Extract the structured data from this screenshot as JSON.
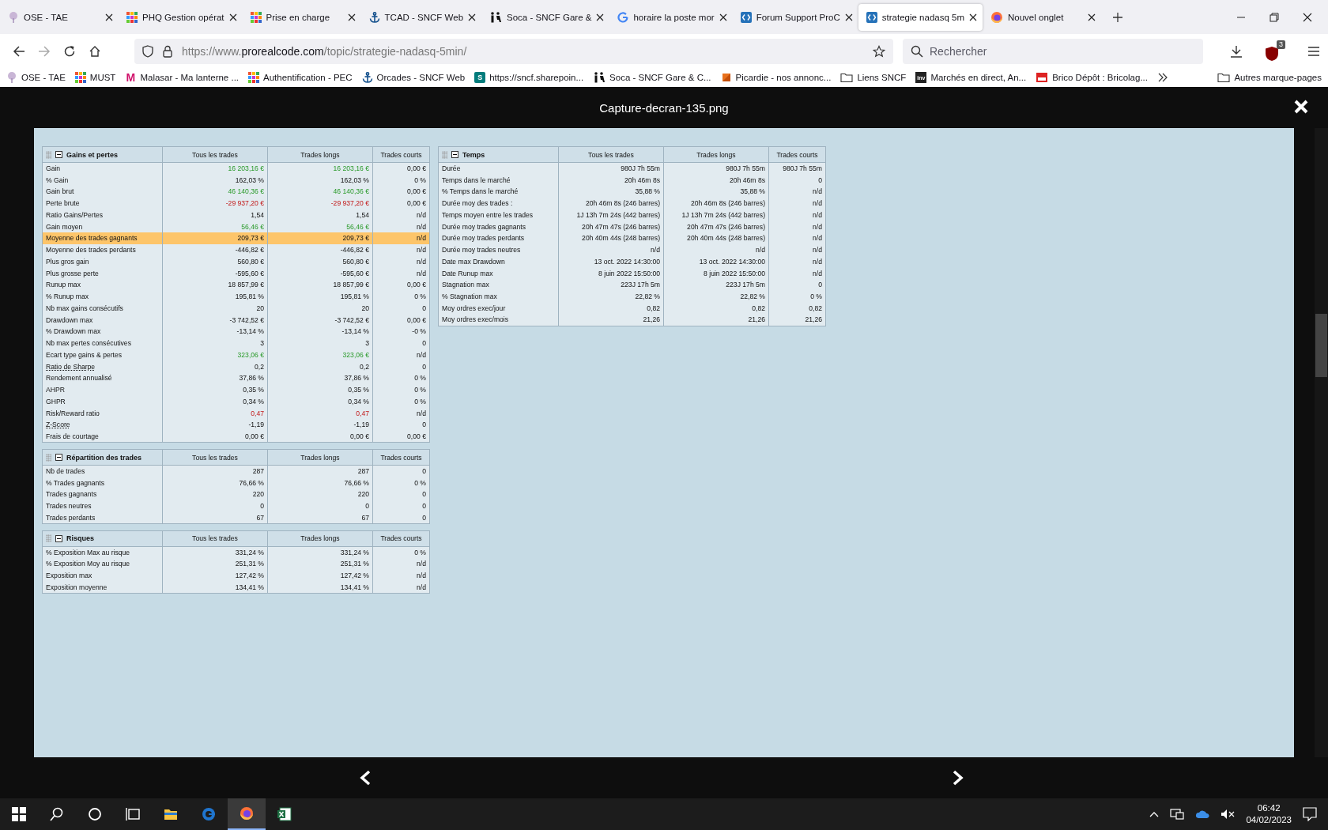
{
  "tabs": [
    {
      "title": "OSE - TAE",
      "kind": "flower",
      "selected": false
    },
    {
      "title": "PHQ Gestion opérat",
      "kind": "grid",
      "selected": false
    },
    {
      "title": "Prise en charge",
      "kind": "grid",
      "selected": false
    },
    {
      "title": "TCAD - SNCF Web",
      "kind": "anchor",
      "selected": false
    },
    {
      "title": "Soca - SNCF Gare &",
      "kind": "people",
      "selected": false
    },
    {
      "title": "horaire la poste mor",
      "kind": "google",
      "selected": false
    },
    {
      "title": "Forum Support ProC",
      "kind": "code",
      "selected": false
    },
    {
      "title": "strategie nadasq 5m",
      "kind": "code",
      "selected": true
    },
    {
      "title": "Nouvel onglet",
      "kind": "firefox",
      "selected": false
    }
  ],
  "address": {
    "prefix": "https://www.",
    "host": "prorealcode.com",
    "path": "/topic/strategie-nadasq-5min/"
  },
  "search": {
    "placeholder": "Rechercher"
  },
  "extension_badge": "3",
  "bookmarks": [
    {
      "label": "OSE - TAE",
      "kind": "flower"
    },
    {
      "label": "MUST",
      "kind": "grid"
    },
    {
      "label": "Malasar - Ma lanterne ...",
      "kind": "letter",
      "icon_text": "M"
    },
    {
      "label": "Authentification - PEC",
      "kind": "grid"
    },
    {
      "label": "Orcades - SNCF Web",
      "kind": "anchor"
    },
    {
      "label": "https://sncf.sharepoin...",
      "kind": "tile",
      "icon_text": "S"
    },
    {
      "label": "Soca - SNCF Gare & C...",
      "kind": "people"
    },
    {
      "label": "Picardie - nos annonc...",
      "kind": "square"
    },
    {
      "label": "Liens SNCF",
      "kind": "folder"
    },
    {
      "label": "Marchés en direct, An...",
      "kind": "dark",
      "icon_text": "inv"
    },
    {
      "label": "Brico Dépôt : Bricolag...",
      "kind": "brick"
    },
    {
      "label": "Autres marque-pages",
      "kind": "folder"
    }
  ],
  "viewer": {
    "title": "Capture-decran-135.png",
    "left_tables": [
      {
        "title": "Gains et pertes",
        "columns": [
          "Tous les trades",
          "Trades longs",
          "Trades courts"
        ],
        "rows": [
          {
            "label": "Gain",
            "values": [
              "16 203,16 €",
              "16 203,16 €",
              "0,00 €"
            ],
            "kind": "positive",
            "selected": false,
            "link": false
          },
          {
            "label": "% Gain",
            "values": [
              "162,03 %",
              "162,03 %",
              "0 %"
            ],
            "selected": false,
            "link": false
          },
          {
            "label": "Gain brut",
            "values": [
              "46 140,36 €",
              "46 140,36 €",
              "0,00 €"
            ],
            "kind": "positive",
            "selected": false,
            "link": false
          },
          {
            "label": "Perte brute",
            "values": [
              "-29 937,20 €",
              "-29 937,20 €",
              "0,00 €"
            ],
            "kind": "negative",
            "selected": false,
            "link": false
          },
          {
            "label": "Ratio Gains/Pertes",
            "values": [
              "1,54",
              "1,54",
              "n/d"
            ],
            "selected": false,
            "link": false
          },
          {
            "label": "Gain moyen",
            "values": [
              "56,46 €",
              "56,46 €",
              "n/d"
            ],
            "kind": "positive",
            "selected": false,
            "link": false
          },
          {
            "label": "Moyenne des trades gagnants",
            "values": [
              "209,73 €",
              "209,73 €",
              "n/d"
            ],
            "selected": true,
            "link": false
          },
          {
            "label": "Moyenne des trades perdants",
            "values": [
              "-446,82 €",
              "-446,82 €",
              "n/d"
            ],
            "selected": false,
            "link": false
          },
          {
            "label": "Plus gros gain",
            "values": [
              "560,80 €",
              "560,80 €",
              "n/d"
            ],
            "selected": false,
            "link": false
          },
          {
            "label": "Plus grosse perte",
            "values": [
              "-595,60 €",
              "-595,60 €",
              "n/d"
            ],
            "selected": false,
            "link": false
          },
          {
            "label": "Runup max",
            "values": [
              "18 857,99 €",
              "18 857,99 €",
              "0,00 €"
            ],
            "selected": false,
            "link": false
          },
          {
            "label": "% Runup max",
            "values": [
              "195,81 %",
              "195,81 %",
              "0 %"
            ],
            "selected": false,
            "link": false
          },
          {
            "label": "Nb max gains consécutifs",
            "values": [
              "20",
              "20",
              "0"
            ],
            "selected": false,
            "link": false
          },
          {
            "label": "Drawdown max",
            "values": [
              "-3 742,52 €",
              "-3 742,52 €",
              "0,00 €"
            ],
            "selected": false,
            "link": false
          },
          {
            "label": "% Drawdown max",
            "values": [
              "-13,14 %",
              "-13,14 %",
              "-0 %"
            ],
            "selected": false,
            "link": false
          },
          {
            "label": "Nb max pertes consécutives",
            "values": [
              "3",
              "3",
              "0"
            ],
            "selected": false,
            "link": false
          },
          {
            "label": "Ecart type gains & pertes",
            "values": [
              "323,06 €",
              "323,06 €",
              "n/d"
            ],
            "kind": "positive",
            "selected": false,
            "link": false
          },
          {
            "label": "Ratio de Sharpe",
            "values": [
              "0,2",
              "0,2",
              "0"
            ],
            "selected": false,
            "link": true
          },
          {
            "label": "Rendement annualisé",
            "values": [
              "37,86 %",
              "37,86 %",
              "0 %"
            ],
            "selected": false,
            "link": false
          },
          {
            "label": "AHPR",
            "values": [
              "0,35 %",
              "0,35 %",
              "0 %"
            ],
            "selected": false,
            "link": false
          },
          {
            "label": "GHPR",
            "values": [
              "0,34 %",
              "0,34 %",
              "0 %"
            ],
            "selected": false,
            "link": false
          },
          {
            "label": "Risk/Reward ratio",
            "values": [
              "0,47",
              "0,47",
              "n/d"
            ],
            "kind": "negative",
            "selected": false,
            "link": false
          },
          {
            "label": "Z-Score",
            "values": [
              "-1,19",
              "-1,19",
              "0"
            ],
            "selected": false,
            "link": true
          },
          {
            "label": "Frais de courtage",
            "values": [
              "0,00 €",
              "0,00 €",
              "0,00 €"
            ],
            "selected": false,
            "link": false
          }
        ]
      },
      {
        "title": "Répartition des trades",
        "columns": [
          "Tous les trades",
          "Trades longs",
          "Trades courts"
        ],
        "rows": [
          {
            "label": "Nb de trades",
            "values": [
              "287",
              "287",
              "0"
            ],
            "selected": false,
            "link": false
          },
          {
            "label": "% Trades gagnants",
            "values": [
              "76,66 %",
              "76,66 %",
              "0 %"
            ],
            "selected": false,
            "link": false
          },
          {
            "label": "Trades gagnants",
            "values": [
              "220",
              "220",
              "0"
            ],
            "selected": false,
            "link": false
          },
          {
            "label": "Trades neutres",
            "values": [
              "0",
              "0",
              "0"
            ],
            "selected": false,
            "link": false
          },
          {
            "label": "Trades perdants",
            "values": [
              "67",
              "67",
              "0"
            ],
            "selected": false,
            "link": false
          }
        ]
      },
      {
        "title": "Risques",
        "columns": [
          "Tous les trades",
          "Trades longs",
          "Trades courts"
        ],
        "rows": [
          {
            "label": "% Exposition Max au risque",
            "values": [
              "331,24 %",
              "331,24 %",
              "0 %"
            ],
            "selected": false,
            "link": false
          },
          {
            "label": "% Exposition Moy au risque",
            "values": [
              "251,31 %",
              "251,31 %",
              "n/d"
            ],
            "selected": false,
            "link": false
          },
          {
            "label": "Exposition max",
            "values": [
              "127,42 %",
              "127,42 %",
              "n/d"
            ],
            "selected": false,
            "link": false
          },
          {
            "label": "Exposition moyenne",
            "values": [
              "134,41 %",
              "134,41 %",
              "n/d"
            ],
            "selected": false,
            "link": false
          }
        ]
      }
    ],
    "right_tables": [
      {
        "title": "Temps",
        "columns": [
          "Tous les trades",
          "Trades longs",
          "Trades courts"
        ],
        "rows": [
          {
            "label": "Durée",
            "values": [
              "980J 7h 55m",
              "980J 7h 55m",
              "980J 7h 55m"
            ],
            "selected": false,
            "link": false
          },
          {
            "label": "Temps dans le marché",
            "values": [
              "20h 46m 8s",
              "20h 46m 8s",
              "0"
            ],
            "selected": false,
            "link": false
          },
          {
            "label": "% Temps dans le marché",
            "values": [
              "35,88 %",
              "35,88 %",
              "n/d"
            ],
            "selected": false,
            "link": false
          },
          {
            "label": "Durée moy des trades :",
            "values": [
              "20h 46m 8s (246 barres)",
              "20h 46m 8s (246 barres)",
              "n/d"
            ],
            "selected": false,
            "link": false
          },
          {
            "label": "Temps moyen entre les trades",
            "values": [
              "1J 13h 7m 24s (442 barres)",
              "1J 13h 7m 24s (442 barres)",
              "n/d"
            ],
            "selected": false,
            "link": false
          },
          {
            "label": "Durée moy trades gagnants",
            "values": [
              "20h 47m 47s (246 barres)",
              "20h 47m 47s (246 barres)",
              "n/d"
            ],
            "selected": false,
            "link": false
          },
          {
            "label": "Durée moy trades perdants",
            "values": [
              "20h 40m 44s (248 barres)",
              "20h 40m 44s (248 barres)",
              "n/d"
            ],
            "selected": false,
            "link": false
          },
          {
            "label": "Durée moy trades neutres",
            "values": [
              "n/d",
              "n/d",
              "n/d"
            ],
            "selected": false,
            "link": false
          },
          {
            "label": "Date max Drawdown",
            "values": [
              "13 oct. 2022 14:30:00",
              "13 oct. 2022 14:30:00",
              "n/d"
            ],
            "selected": false,
            "link": false
          },
          {
            "label": "Date Runup max",
            "values": [
              "8 juin 2022 15:50:00",
              "8 juin 2022 15:50:00",
              "n/d"
            ],
            "selected": false,
            "link": false
          },
          {
            "label": "Stagnation max",
            "values": [
              "223J 17h 5m",
              "223J 17h 5m",
              "0"
            ],
            "selected": false,
            "link": false
          },
          {
            "label": "% Stagnation max",
            "values": [
              "22,82 %",
              "22,82 %",
              "0 %"
            ],
            "selected": false,
            "link": false
          },
          {
            "label": "Moy ordres exec/jour",
            "values": [
              "0,82",
              "0,82",
              "0,82"
            ],
            "selected": false,
            "link": false
          },
          {
            "label": "Moy ordres exec/mois",
            "values": [
              "21,26",
              "21,26",
              "21,26"
            ],
            "selected": false,
            "link": false
          }
        ]
      }
    ]
  },
  "taskbar": {
    "apps": [
      {
        "kind": "explorer",
        "selected": false
      },
      {
        "kind": "edge",
        "selected": false
      },
      {
        "kind": "firefox",
        "selected": true
      },
      {
        "kind": "excel",
        "selected": false
      }
    ],
    "time": "06:42",
    "date": "04/02/2023"
  }
}
